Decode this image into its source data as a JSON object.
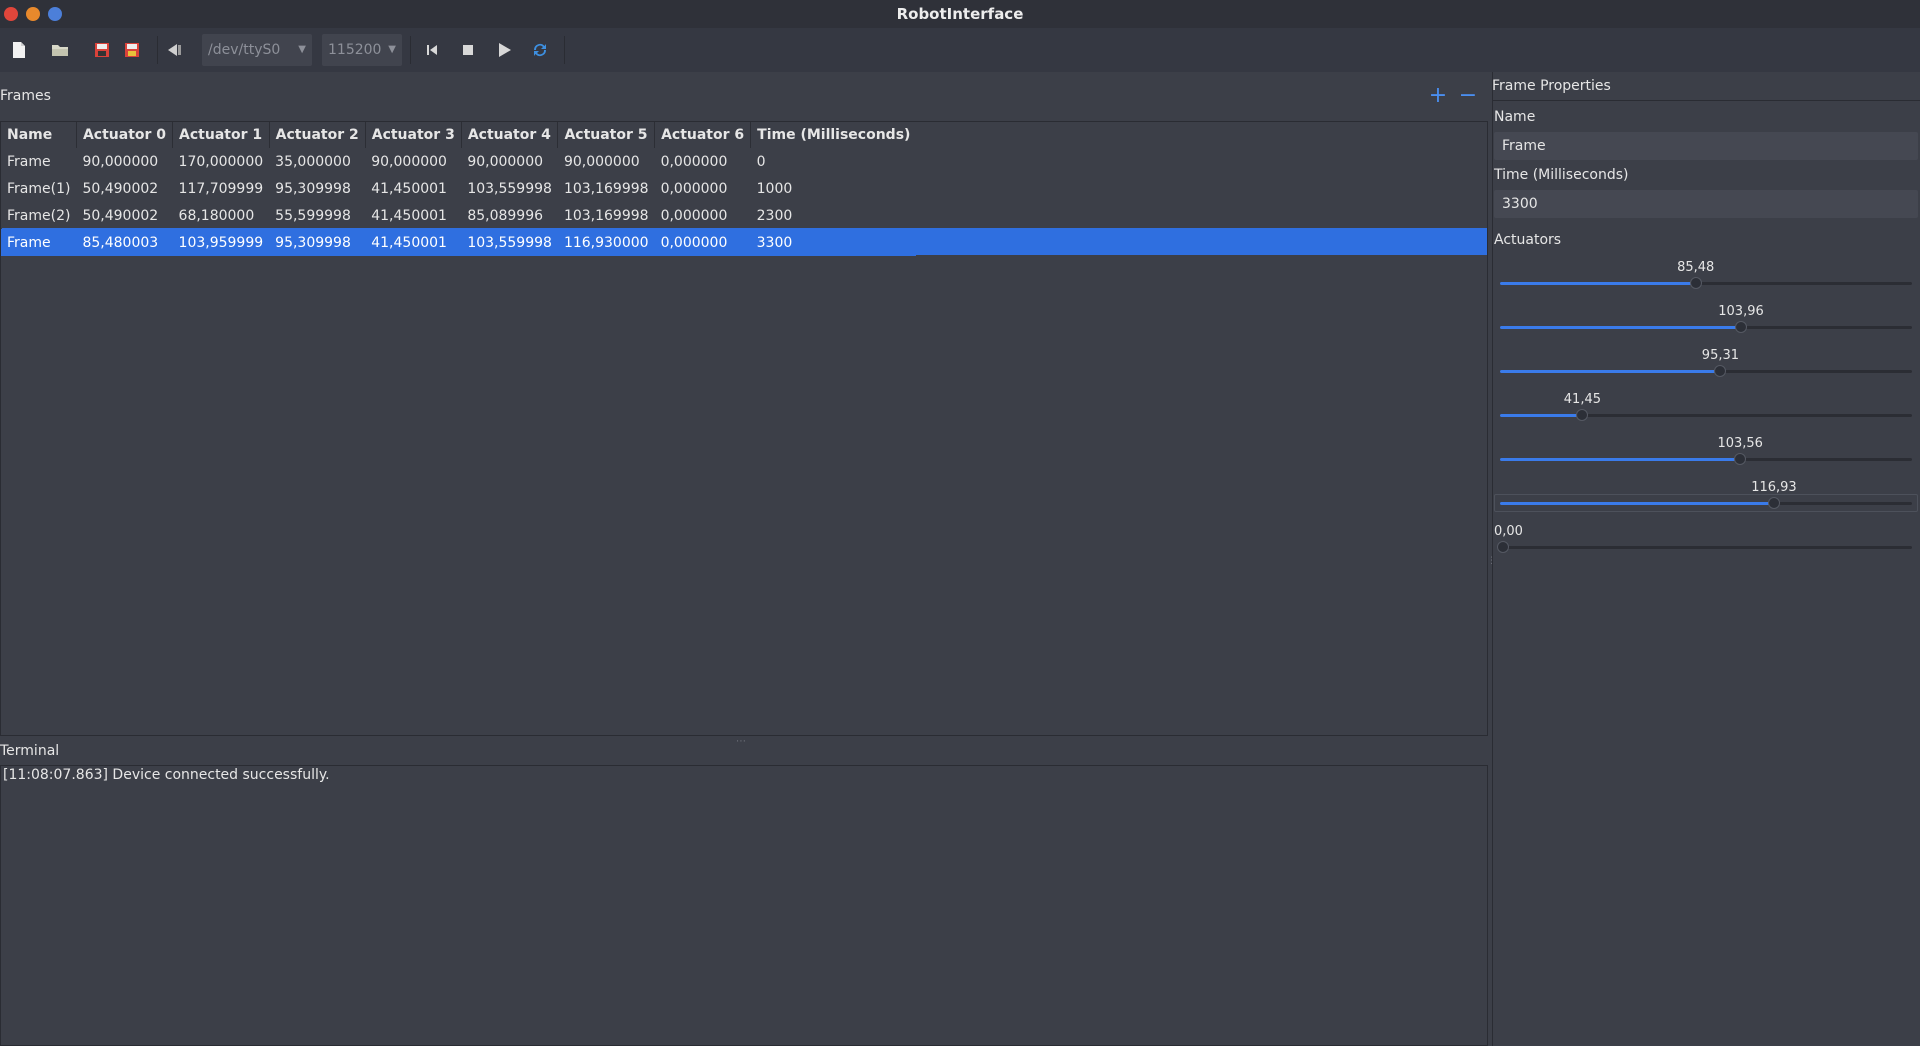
{
  "window": {
    "title": "RobotInterface"
  },
  "colors": {
    "accent": "#2f6fe0",
    "background": "#3c3f48",
    "close": "#e0463b",
    "minimize": "#e8892c",
    "maximize": "#4c7fd9"
  },
  "toolbar": {
    "icons": [
      "new-file-icon",
      "open-folder-icon",
      "save-icon",
      "save-as-icon",
      "connect-icon",
      "skip-back-icon",
      "stop-icon",
      "play-icon",
      "refresh-icon"
    ],
    "port": "/dev/ttyS0",
    "baud": "115200"
  },
  "frames": {
    "title": "Frames",
    "add_label": "+",
    "remove_label": "−",
    "columns": [
      "Name",
      "Actuator 0",
      "Actuator 1",
      "Actuator 2",
      "Actuator 3",
      "Actuator 4",
      "Actuator 5",
      "Actuator 6",
      "Time (Milliseconds)"
    ],
    "rows": [
      [
        "Frame",
        "90,000000",
        "170,000000",
        "35,000000",
        "90,000000",
        "90,000000",
        "90,000000",
        "0,000000",
        "0"
      ],
      [
        "Frame(1)",
        "50,490002",
        "117,709999",
        "95,309998",
        "41,450001",
        "103,559998",
        "103,169998",
        "0,000000",
        "1000"
      ],
      [
        "Frame(2)",
        "50,490002",
        "68,180000",
        "55,599998",
        "41,450001",
        "85,089996",
        "103,169998",
        "0,000000",
        "2300"
      ],
      [
        "Frame",
        "85,480003",
        "103,959999",
        "95,309998",
        "41,450001",
        "103,559998",
        "116,930000",
        "0,000000",
        "3300"
      ]
    ],
    "selected_row": 3
  },
  "terminal": {
    "title": "Terminal",
    "lines": [
      "[11:08:07.863] Device connected successfully."
    ]
  },
  "properties": {
    "title": "Frame Properties",
    "name_label": "Name",
    "name_value": "Frame",
    "time_label": "Time (Milliseconds)",
    "time_value": "3300",
    "actuators_label": "Actuators",
    "sliders": [
      {
        "label": "85,48",
        "fraction": 0.475
      },
      {
        "label": "103,96",
        "fraction": 0.585
      },
      {
        "label": "95,31",
        "fraction": 0.535
      },
      {
        "label": "41,45",
        "fraction": 0.2
      },
      {
        "label": "103,56",
        "fraction": 0.583
      },
      {
        "label": "116,93",
        "fraction": 0.665
      },
      {
        "label": "0,00",
        "fraction": 0.0
      }
    ]
  }
}
